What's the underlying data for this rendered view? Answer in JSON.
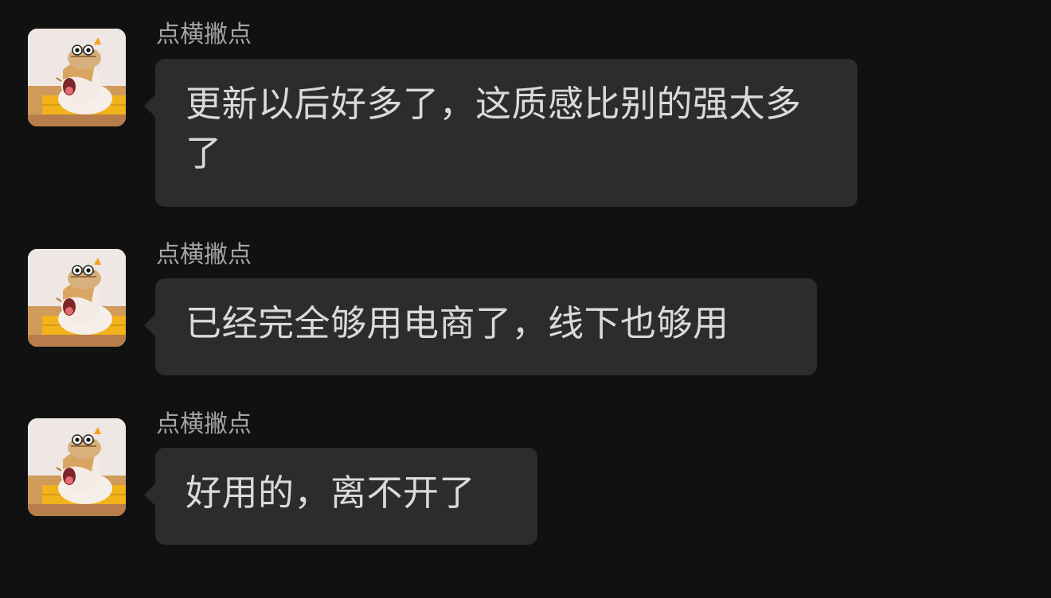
{
  "messages": [
    {
      "sender": "点横撇点",
      "text": "更新以后好多了，这质感比别的强太多了",
      "avatar": "cat-with-hat-avatar"
    },
    {
      "sender": "点横撇点",
      "text": "已经完全够用电商了，线下也够用",
      "avatar": "cat-with-hat-avatar"
    },
    {
      "sender": "点横撇点",
      "text": "好用的，离不开了",
      "avatar": "cat-with-hat-avatar"
    }
  ],
  "colors": {
    "background": "#111111",
    "bubble": "#2c2c2c",
    "bubble_text": "#dadada",
    "sender_text": "#a4a4a4"
  }
}
